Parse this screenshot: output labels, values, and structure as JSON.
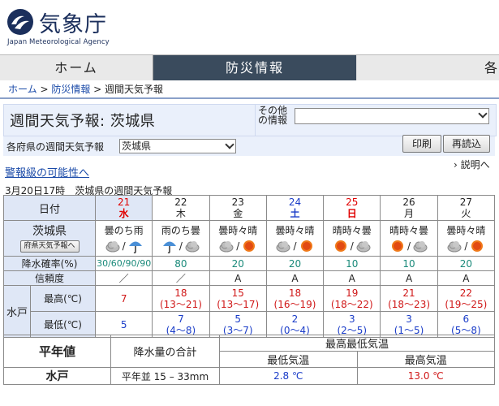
{
  "header": {
    "logo_jp": "気象庁",
    "logo_en": "Japan Meteorological Agency"
  },
  "nav": {
    "home": "ホーム",
    "bousai": "防災情報",
    "more": "各"
  },
  "breadcrumb": {
    "home": "ホーム",
    "bousai": "防災情報",
    "current": "週間天気予報"
  },
  "title": "週間天気予報: 茨城県",
  "other_info_label": "その他の情報",
  "pref_label": "各府県の週間天気予報",
  "pref_value": "茨城県",
  "buttons": {
    "print": "印刷",
    "reload": "再読込"
  },
  "setsumei": "説明へ",
  "warn_link": "警報級の可能性へ",
  "report": {
    "time": "3月20日17時",
    "title": "茨城県の週間天気予報"
  },
  "table": {
    "col_date": "日付",
    "region": "茨城県",
    "pref_button": "府県天気予報へ",
    "row_pop": "降水確率(%)",
    "row_rel": "信頼度",
    "city": "水戸",
    "row_max": "最高(℃)",
    "row_min": "最低(℃)",
    "days": [
      {
        "date": "21",
        "dow": "水",
        "type": "wd",
        "weather": "曇のち雨",
        "icons": [
          "cloud",
          "umbrella"
        ],
        "pop": "30/60/90/90",
        "rel": "／",
        "max": "7",
        "max_range": "",
        "min": "5",
        "min_range": ""
      },
      {
        "date": "22",
        "dow": "木",
        "type": "",
        "weather": "雨のち曇",
        "icons": [
          "umbrella",
          "cloud"
        ],
        "pop": "80",
        "rel": "／",
        "max": "18",
        "max_range": "(13～21)",
        "min": "7",
        "min_range": "(4～8)"
      },
      {
        "date": "23",
        "dow": "金",
        "type": "",
        "weather": "曇時々晴",
        "icons": [
          "cloud",
          "sun"
        ],
        "pop": "20",
        "rel": "A",
        "max": "15",
        "max_range": "(13～17)",
        "min": "5",
        "min_range": "(3～7)"
      },
      {
        "date": "24",
        "dow": "土",
        "type": "sat",
        "weather": "曇時々晴",
        "icons": [
          "cloud",
          "sun"
        ],
        "pop": "20",
        "rel": "A",
        "max": "18",
        "max_range": "(16～19)",
        "min": "2",
        "min_range": "(0～4)"
      },
      {
        "date": "25",
        "dow": "日",
        "type": "sun",
        "weather": "晴時々曇",
        "icons": [
          "sun",
          "cloud"
        ],
        "pop": "10",
        "rel": "A",
        "max": "19",
        "max_range": "(18～22)",
        "min": "3",
        "min_range": "(2～5)"
      },
      {
        "date": "26",
        "dow": "月",
        "type": "",
        "weather": "晴時々曇",
        "icons": [
          "sun",
          "cloud"
        ],
        "pop": "10",
        "rel": "A",
        "max": "21",
        "max_range": "(18～23)",
        "min": "3",
        "min_range": "(1～5)"
      },
      {
        "date": "27",
        "dow": "火",
        "type": "",
        "weather": "曇時々晴",
        "icons": [
          "cloud",
          "sun"
        ],
        "pop": "20",
        "rel": "A",
        "max": "22",
        "max_range": "(19～25)",
        "min": "6",
        "min_range": "(5～8)"
      }
    ]
  },
  "normals": {
    "heading": "平年値",
    "precip_label": "降水量の合計",
    "maxmin_label": "最高最低気温",
    "min_label": "最低気温",
    "max_label": "最高気温",
    "city": "水戸",
    "precip_value": "平年並 15 – 33mm",
    "min_value": "2.8 ℃",
    "max_value": "13.0 ℃"
  },
  "colors": {
    "nav_active": "#3a4b5d",
    "header_cell": "#dfe7f6",
    "sunday": "#e00000",
    "saturday": "#1a3cc8"
  }
}
